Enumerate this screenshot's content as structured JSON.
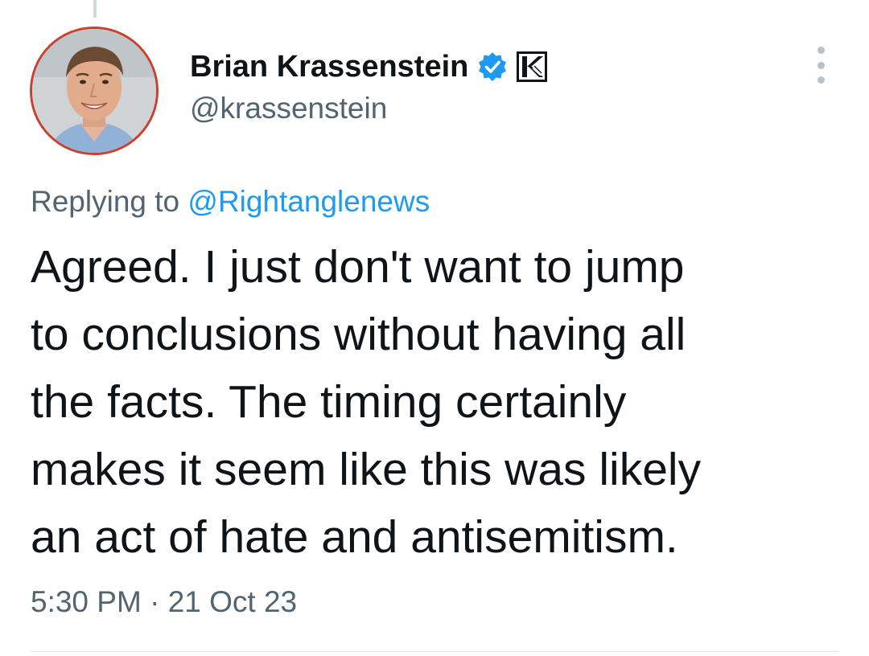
{
  "tweet": {
    "author": {
      "display_name": "Brian Krassenstein",
      "handle": "@krassenstein",
      "verified_icon": "verified-badge-icon",
      "affiliation_icon": "k-logo-icon",
      "avatar": "profile-photo"
    },
    "reply_context": {
      "prefix": "Replying to",
      "mention": "@Rightanglenews"
    },
    "text": "Agreed.  I just don't want to jump\nto conclusions without having all\nthe facts.  The timing certainly\nmakes it seem like this was likely\nan act of hate and antisemitism.",
    "time": "5:30 PM",
    "separator": "·",
    "date": "21 Oct 23",
    "more_icon": "more-options-icon"
  },
  "colors": {
    "text": "#0f1419",
    "secondary": "#536471",
    "accent": "#1d9bf0",
    "avatar_border": "#c9412e"
  }
}
